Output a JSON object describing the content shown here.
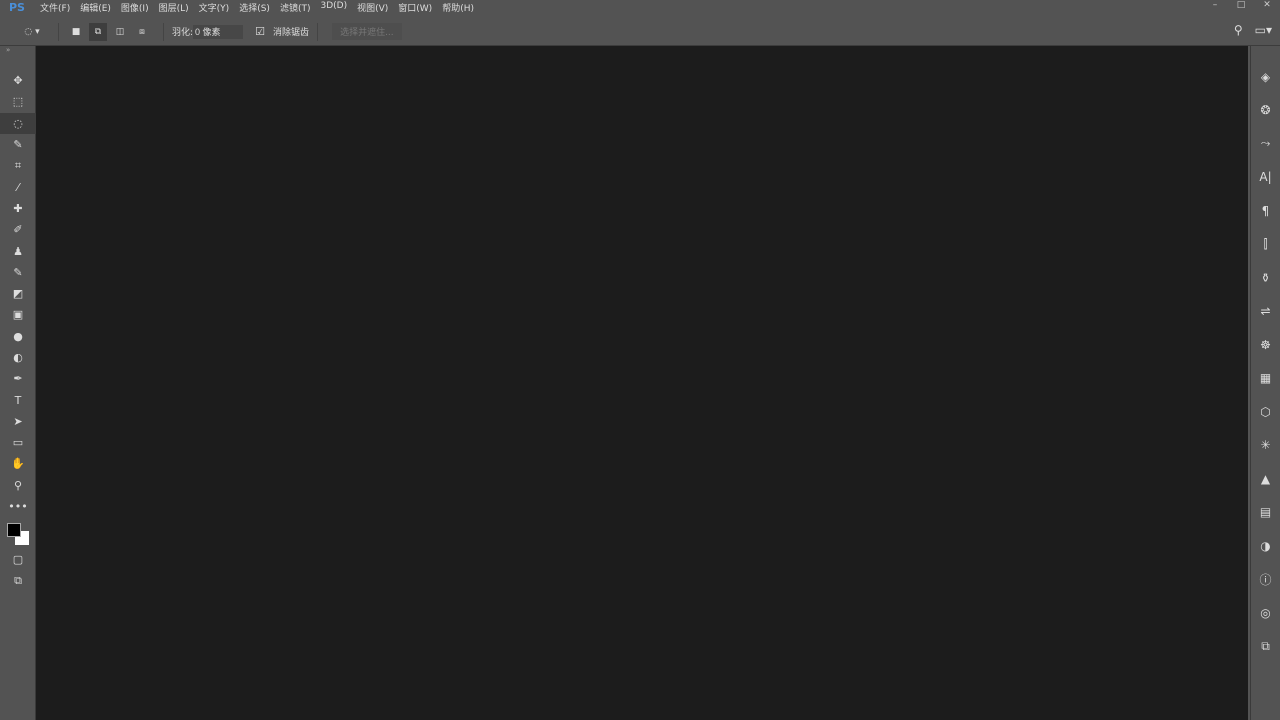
{
  "app": {
    "logo": "PS"
  },
  "menu": [
    "文件(F)",
    "编辑(E)",
    "图像(I)",
    "图层(L)",
    "文字(Y)",
    "选择(S)",
    "滤镜(T)",
    "3D(D)",
    "视图(V)",
    "窗口(W)",
    "帮助(H)"
  ],
  "window_controls": {
    "minimize": "–",
    "maximize": "□",
    "close": "✕"
  },
  "options": {
    "feather_label": "羽化:",
    "feather_value": "0 像素",
    "antialias_label": "消除锯齿",
    "antialias_checked": true,
    "refine_label": "选择并遮住..."
  },
  "tools": [
    {
      "name": "move",
      "glyph": "✥"
    },
    {
      "name": "marquee",
      "glyph": "⬚"
    },
    {
      "name": "lasso",
      "glyph": "◌",
      "active": true
    },
    {
      "name": "quick-select",
      "glyph": "✎"
    },
    {
      "name": "crop",
      "glyph": "⌗"
    },
    {
      "name": "eyedropper",
      "glyph": "⁄"
    },
    {
      "name": "healing",
      "glyph": "✚"
    },
    {
      "name": "brush",
      "glyph": "✐"
    },
    {
      "name": "stamp",
      "glyph": "♟"
    },
    {
      "name": "history-brush",
      "glyph": "✎"
    },
    {
      "name": "eraser",
      "glyph": "◩"
    },
    {
      "name": "gradient",
      "glyph": "▣"
    },
    {
      "name": "blur",
      "glyph": "●"
    },
    {
      "name": "dodge",
      "glyph": "◐"
    },
    {
      "name": "pen",
      "glyph": "✒"
    },
    {
      "name": "type",
      "glyph": "T"
    },
    {
      "name": "path-select",
      "glyph": "➤"
    },
    {
      "name": "rectangle",
      "glyph": "▭"
    },
    {
      "name": "hand",
      "glyph": "✋"
    },
    {
      "name": "zoom",
      "glyph": "⚲"
    },
    {
      "name": "more",
      "glyph": "•••"
    }
  ],
  "panels": [
    "layers",
    "channels",
    "paths",
    "character",
    "paragraph",
    "brush-settings",
    "clone-source",
    "adjustments",
    "styles",
    "grid",
    "3d",
    "properties",
    "swatches",
    "libraries",
    "color",
    "info",
    "cc-libraries",
    "navigator"
  ],
  "panel_glyphs": [
    "◈",
    "❂",
    "⤳",
    "A|",
    "¶",
    "⫿",
    "⚱",
    "⇌",
    "☸",
    "▦",
    "⬡",
    "✳",
    "▲",
    "▤",
    "◑",
    "ⓘ",
    "◎",
    "⧉"
  ],
  "colors": {
    "foreground": "#000000",
    "background": "#ffffff",
    "canvas": "#1c1c1c",
    "chrome": "#535353"
  }
}
